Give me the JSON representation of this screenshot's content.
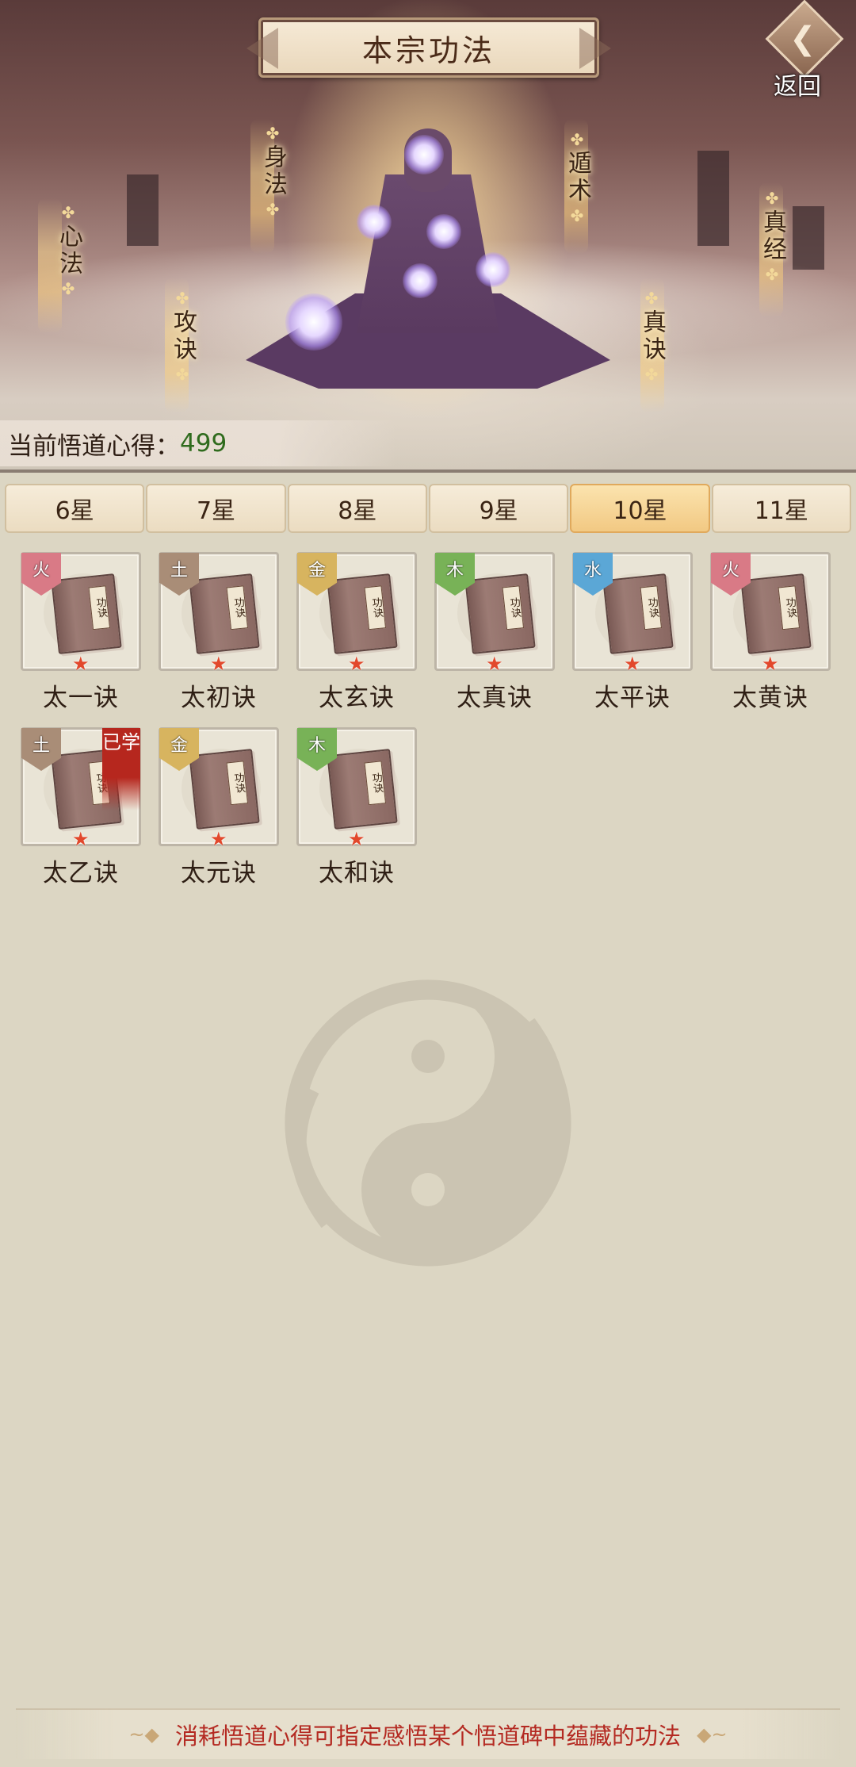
{
  "header": {
    "title": "本宗功法",
    "back_label": "返回",
    "categories": [
      {
        "id": "xinfa",
        "label": "心法"
      },
      {
        "id": "shenfa",
        "label": "身法"
      },
      {
        "id": "gongjue",
        "label": "攻诀"
      },
      {
        "id": "dunshu",
        "label": "遁术"
      },
      {
        "id": "zhenjue",
        "label": "真诀"
      },
      {
        "id": "zhenjing",
        "label": "真经"
      }
    ],
    "insight_label": "当前悟道心得：",
    "insight_value": "499"
  },
  "tabs": [
    {
      "label": "6星",
      "active": false
    },
    {
      "label": "7星",
      "active": false
    },
    {
      "label": "8星",
      "active": false
    },
    {
      "label": "9星",
      "active": false
    },
    {
      "label": "10星",
      "active": true
    },
    {
      "label": "11星",
      "active": false
    }
  ],
  "techniques": [
    {
      "name": "太一诀",
      "element": "火",
      "element_type": "fire",
      "learned": false
    },
    {
      "name": "太初诀",
      "element": "土",
      "element_type": "earth",
      "learned": false
    },
    {
      "name": "太玄诀",
      "element": "金",
      "element_type": "metal",
      "learned": false
    },
    {
      "name": "太真诀",
      "element": "木",
      "element_type": "wood",
      "learned": false
    },
    {
      "name": "太平诀",
      "element": "水",
      "element_type": "water",
      "learned": false
    },
    {
      "name": "太黄诀",
      "element": "火",
      "element_type": "fire",
      "learned": false
    },
    {
      "name": "太乙诀",
      "element": "土",
      "element_type": "earth",
      "learned": true
    },
    {
      "name": "太元诀",
      "element": "金",
      "element_type": "metal",
      "learned": false
    },
    {
      "name": "太和诀",
      "element": "木",
      "element_type": "wood",
      "learned": false
    }
  ],
  "learned_badge": "已学",
  "book_cover_text": "功诀",
  "footer": {
    "hint": "消耗悟道心得可指定感悟某个悟道碑中蕴藏的功法"
  },
  "colors": {
    "accent_active_tab": "#f2c983",
    "insight_value": "#2f6b1d",
    "hint_text": "#b42a22",
    "learned_badge": "#b6271e"
  }
}
